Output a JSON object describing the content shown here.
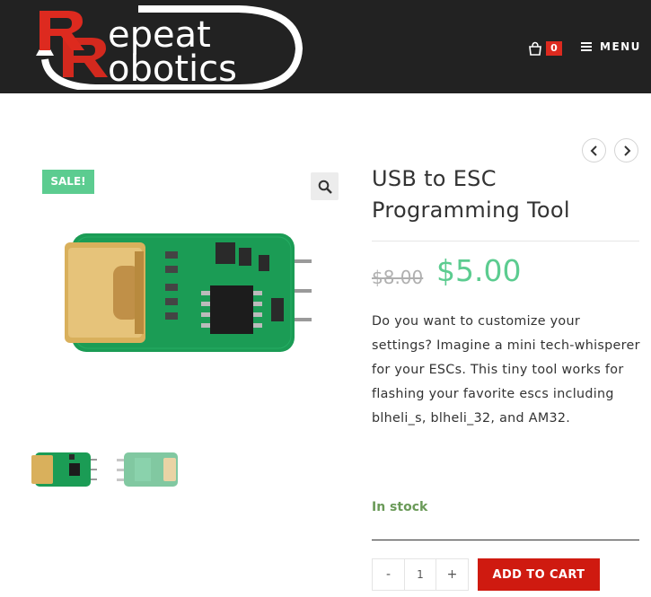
{
  "header": {
    "logo_text": "Repeat Robotics",
    "cart_count": "0",
    "menu_label": "MENU",
    "brand_color": "#dd2a1f",
    "background": "#222222"
  },
  "nav": {
    "prev_icon": "chevron-left-icon",
    "next_icon": "chevron-right-icon"
  },
  "gallery": {
    "sale_badge": "SALE!",
    "zoom_icon": "magnifier-icon",
    "thumbnails": [
      "front",
      "back"
    ]
  },
  "product": {
    "title": "USB to ESC Programming Tool",
    "old_price": "$8.00",
    "price": "$5.00",
    "description": "Do you want to customize your settings? Imagine a mini tech-whisperer for your ESCs. This tiny tool works for flashing your favorite escs including blheli_s, blheli_32, and AM32.",
    "stock": "In stock",
    "quantity": "1",
    "minus_label": "-",
    "plus_label": "+",
    "add_to_cart": "ADD TO CART",
    "price_color": "#5ccc90",
    "button_color": "#cf1a10"
  }
}
